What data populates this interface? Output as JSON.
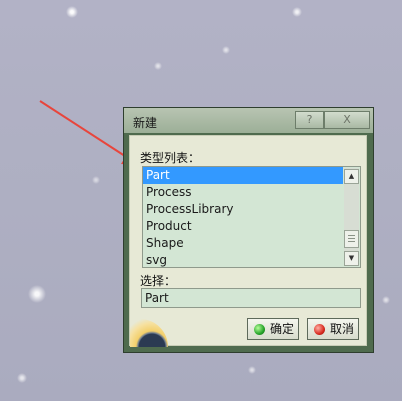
{
  "colors": {
    "arrow": "#e8453c",
    "selection": "#3399ff",
    "listbox_bg": "#d3e6d4",
    "dialog_bg": "#e7e9d6"
  },
  "dialog": {
    "title": "新建",
    "help_label": "?",
    "close_label": "X",
    "type_list_label": "类型列表：",
    "selection_label": "选择：",
    "selection_value": "Part",
    "list_items": [
      "Part",
      "Process",
      "ProcessLibrary",
      "Product",
      "Shape",
      "svg"
    ],
    "selected_index": 0,
    "ok_label": "确定",
    "cancel_label": "取消",
    "scroll_up_icon": "scroll-up-arrow",
    "scroll_down_icon": "scroll-down-arrow"
  }
}
